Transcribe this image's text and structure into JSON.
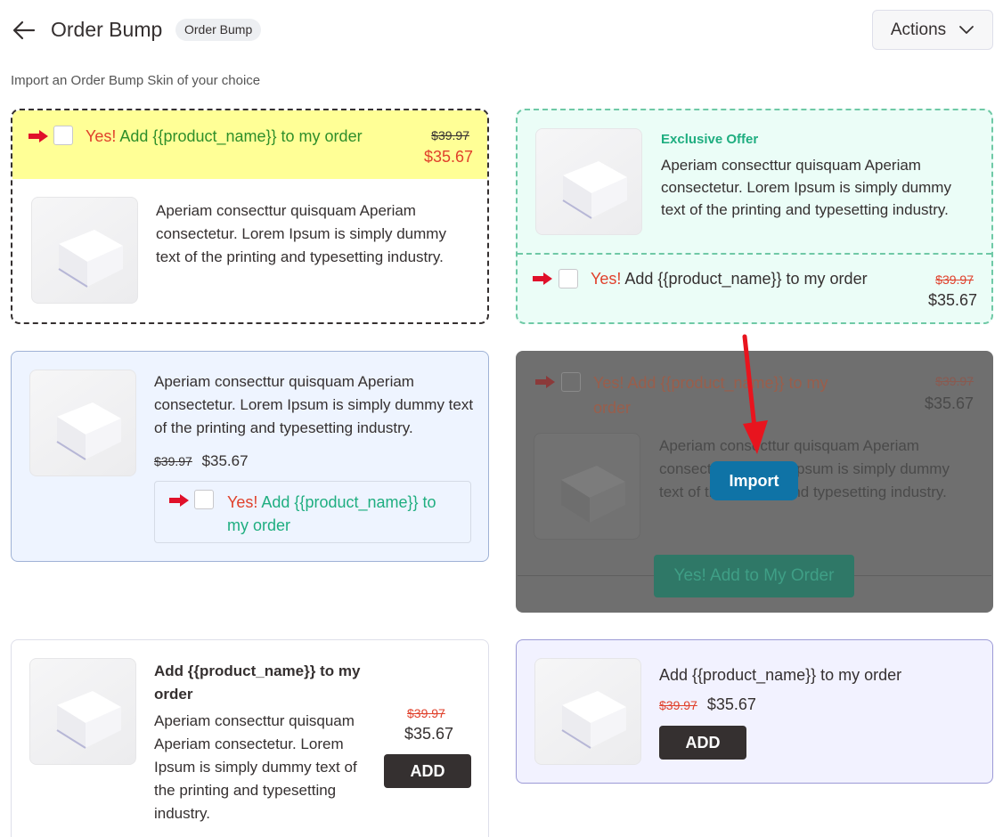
{
  "header": {
    "title": "Order Bump",
    "badge": "Order Bump",
    "actions_label": "Actions"
  },
  "subtitle": "Import an Order Bump Skin of your choice",
  "colors": {
    "accent_red": "#e0412c",
    "accent_green": "#1fae80",
    "import_blue": "#0f73a6",
    "dark": "#353030"
  },
  "skins": {
    "skin1": {
      "yes": "Yes!",
      "headline": "Add {{product_name}} to my order",
      "old_price": "$39.97",
      "new_price": "$35.67",
      "description": "Aperiam consecttur quisquam Aperiam consectetur. Lorem Ipsum is simply dummy text of the printing and typesetting industry."
    },
    "skin2": {
      "eyebrow": "Exclusive Offer",
      "description": "Aperiam consecttur quisquam Aperiam consectetur. Lorem Ipsum is simply dummy text of the printing and typesetting industry.",
      "yes": "Yes!",
      "headline": "Add {{product_name}} to my order",
      "old_price": "$39.97",
      "new_price": "$35.67"
    },
    "skin3": {
      "description": "Aperiam consecttur quisquam Aperiam consectetur. Lorem Ipsum is simply dummy text of the printing and typesetting industry.",
      "old_price": "$39.97",
      "new_price": "$35.67",
      "yes": "Yes!",
      "headline": "Add {{product_name}} to my order"
    },
    "skin4": {
      "yes": "Yes!",
      "headline": "Add {{product_name}} to my order",
      "old_price": "$39.97",
      "new_price": "$35.67",
      "description": "Aperiam consecttur quisquam Aperiam consectetur. Lorem Ipsum is simply dummy text of the printing and typesetting industry.",
      "cta": "Yes! Add to My Order",
      "import_label": "Import"
    },
    "skin5": {
      "title": "Add {{product_name}} to my order",
      "description": "Aperiam consecttur quisquam Aperiam consectetur. Lorem Ipsum is simply dummy text of the printing and typesetting industry.",
      "old_price": "$39.97",
      "new_price": "$35.67",
      "add_label": "ADD"
    },
    "skin6": {
      "title": "Add {{product_name}} to my order",
      "old_price": "$39.97",
      "new_price": "$35.67",
      "add_label": "ADD"
    }
  },
  "icons": {
    "back": "arrow-left-icon",
    "actions": "chevron-down-icon",
    "pointer": "red-arrow-icon",
    "product": "product-box-icon"
  }
}
